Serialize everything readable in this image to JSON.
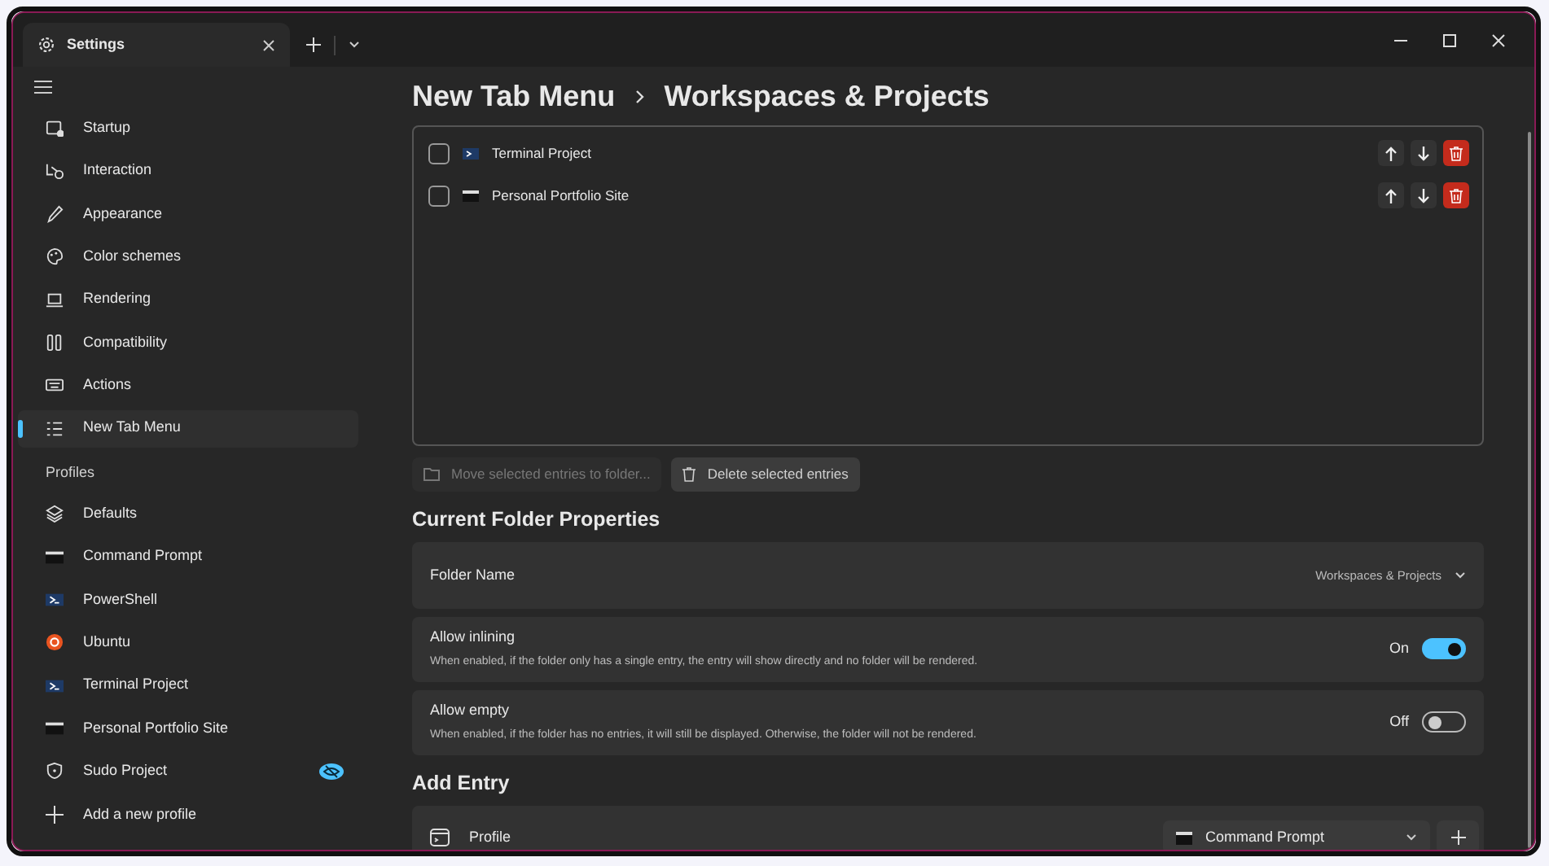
{
  "tab": {
    "title": "Settings"
  },
  "sidebar": {
    "items": [
      {
        "label": "Startup",
        "selected": false
      },
      {
        "label": "Interaction",
        "selected": false
      },
      {
        "label": "Appearance",
        "selected": false
      },
      {
        "label": "Color schemes",
        "selected": false
      },
      {
        "label": "Rendering",
        "selected": false
      },
      {
        "label": "Compatibility",
        "selected": false
      },
      {
        "label": "Actions",
        "selected": false
      },
      {
        "label": "New Tab Menu",
        "selected": true
      }
    ],
    "profiles_header": "Profiles",
    "profiles": [
      {
        "label": "Defaults",
        "selected": false,
        "hidden": false
      },
      {
        "label": "Command Prompt",
        "selected": false,
        "hidden": false
      },
      {
        "label": "PowerShell",
        "selected": false,
        "hidden": false
      },
      {
        "label": "Ubuntu",
        "selected": false,
        "hidden": false
      },
      {
        "label": "Terminal Project",
        "selected": false,
        "hidden": false
      },
      {
        "label": "Personal Portfolio Site",
        "selected": false,
        "hidden": false
      },
      {
        "label": "Sudo Project",
        "selected": false,
        "hidden": true
      }
    ],
    "add_profile": "Add a new profile"
  },
  "breadcrumb": [
    "New Tab Menu",
    "Workspaces & Projects"
  ],
  "entries": [
    {
      "label": "Terminal Project",
      "checked": false
    },
    {
      "label": "Personal Portfolio Site",
      "checked": false
    }
  ],
  "actions": [
    {
      "label": "Move selected entries to folder...",
      "disabled": true
    },
    {
      "label": "Delete selected entries",
      "disabled": false
    }
  ],
  "folder_section": {
    "title": "Current Folder Properties",
    "folder_name": {
      "label": "Folder Name",
      "value": "Workspaces & Projects"
    },
    "toggles": [
      {
        "label": "Allow inlining",
        "description": "When enabled, if the folder only has a single entry, the entry will show directly and no folder will be rendered.",
        "on": true,
        "state_text": "On"
      },
      {
        "label": "Allow empty",
        "description": "When enabled, if the folder has no entries, it will still be displayed. Otherwise, the folder will not be rendered.",
        "on": false,
        "state_text": "Off"
      }
    ]
  },
  "add_entry": {
    "title": "Add Entry",
    "label": "Profile",
    "value": "Command Prompt"
  }
}
